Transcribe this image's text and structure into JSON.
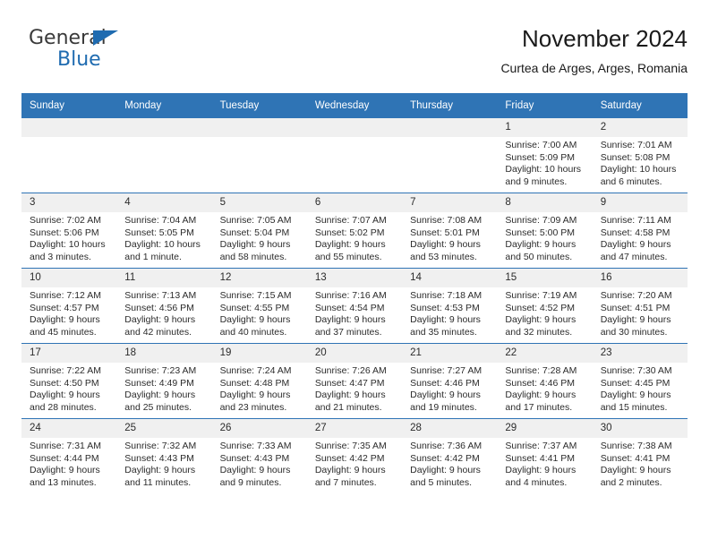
{
  "brand": {
    "name_part1": "General",
    "name_part2": "Blue",
    "triangle_color": "#1f6bb0"
  },
  "header": {
    "title": "November 2024",
    "subtitle": "Curtea de Arges, Arges, Romania"
  },
  "colors": {
    "header_blue": "#2f74b5",
    "daynum_gray": "#f0f0f0",
    "text": "#2b2b2b"
  },
  "calendar": {
    "weekday_headers": [
      "Sunday",
      "Monday",
      "Tuesday",
      "Wednesday",
      "Thursday",
      "Friday",
      "Saturday"
    ],
    "weeks": [
      [
        {
          "day": "",
          "empty": true
        },
        {
          "day": "",
          "empty": true
        },
        {
          "day": "",
          "empty": true
        },
        {
          "day": "",
          "empty": true
        },
        {
          "day": "",
          "empty": true
        },
        {
          "day": "1",
          "sunrise": "Sunrise: 7:00 AM",
          "sunset": "Sunset: 5:09 PM",
          "daylight": "Daylight: 10 hours and 9 minutes."
        },
        {
          "day": "2",
          "sunrise": "Sunrise: 7:01 AM",
          "sunset": "Sunset: 5:08 PM",
          "daylight": "Daylight: 10 hours and 6 minutes."
        }
      ],
      [
        {
          "day": "3",
          "sunrise": "Sunrise: 7:02 AM",
          "sunset": "Sunset: 5:06 PM",
          "daylight": "Daylight: 10 hours and 3 minutes."
        },
        {
          "day": "4",
          "sunrise": "Sunrise: 7:04 AM",
          "sunset": "Sunset: 5:05 PM",
          "daylight": "Daylight: 10 hours and 1 minute."
        },
        {
          "day": "5",
          "sunrise": "Sunrise: 7:05 AM",
          "sunset": "Sunset: 5:04 PM",
          "daylight": "Daylight: 9 hours and 58 minutes."
        },
        {
          "day": "6",
          "sunrise": "Sunrise: 7:07 AM",
          "sunset": "Sunset: 5:02 PM",
          "daylight": "Daylight: 9 hours and 55 minutes."
        },
        {
          "day": "7",
          "sunrise": "Sunrise: 7:08 AM",
          "sunset": "Sunset: 5:01 PM",
          "daylight": "Daylight: 9 hours and 53 minutes."
        },
        {
          "day": "8",
          "sunrise": "Sunrise: 7:09 AM",
          "sunset": "Sunset: 5:00 PM",
          "daylight": "Daylight: 9 hours and 50 minutes."
        },
        {
          "day": "9",
          "sunrise": "Sunrise: 7:11 AM",
          "sunset": "Sunset: 4:58 PM",
          "daylight": "Daylight: 9 hours and 47 minutes."
        }
      ],
      [
        {
          "day": "10",
          "sunrise": "Sunrise: 7:12 AM",
          "sunset": "Sunset: 4:57 PM",
          "daylight": "Daylight: 9 hours and 45 minutes."
        },
        {
          "day": "11",
          "sunrise": "Sunrise: 7:13 AM",
          "sunset": "Sunset: 4:56 PM",
          "daylight": "Daylight: 9 hours and 42 minutes."
        },
        {
          "day": "12",
          "sunrise": "Sunrise: 7:15 AM",
          "sunset": "Sunset: 4:55 PM",
          "daylight": "Daylight: 9 hours and 40 minutes."
        },
        {
          "day": "13",
          "sunrise": "Sunrise: 7:16 AM",
          "sunset": "Sunset: 4:54 PM",
          "daylight": "Daylight: 9 hours and 37 minutes."
        },
        {
          "day": "14",
          "sunrise": "Sunrise: 7:18 AM",
          "sunset": "Sunset: 4:53 PM",
          "daylight": "Daylight: 9 hours and 35 minutes."
        },
        {
          "day": "15",
          "sunrise": "Sunrise: 7:19 AM",
          "sunset": "Sunset: 4:52 PM",
          "daylight": "Daylight: 9 hours and 32 minutes."
        },
        {
          "day": "16",
          "sunrise": "Sunrise: 7:20 AM",
          "sunset": "Sunset: 4:51 PM",
          "daylight": "Daylight: 9 hours and 30 minutes."
        }
      ],
      [
        {
          "day": "17",
          "sunrise": "Sunrise: 7:22 AM",
          "sunset": "Sunset: 4:50 PM",
          "daylight": "Daylight: 9 hours and 28 minutes."
        },
        {
          "day": "18",
          "sunrise": "Sunrise: 7:23 AM",
          "sunset": "Sunset: 4:49 PM",
          "daylight": "Daylight: 9 hours and 25 minutes."
        },
        {
          "day": "19",
          "sunrise": "Sunrise: 7:24 AM",
          "sunset": "Sunset: 4:48 PM",
          "daylight": "Daylight: 9 hours and 23 minutes."
        },
        {
          "day": "20",
          "sunrise": "Sunrise: 7:26 AM",
          "sunset": "Sunset: 4:47 PM",
          "daylight": "Daylight: 9 hours and 21 minutes."
        },
        {
          "day": "21",
          "sunrise": "Sunrise: 7:27 AM",
          "sunset": "Sunset: 4:46 PM",
          "daylight": "Daylight: 9 hours and 19 minutes."
        },
        {
          "day": "22",
          "sunrise": "Sunrise: 7:28 AM",
          "sunset": "Sunset: 4:46 PM",
          "daylight": "Daylight: 9 hours and 17 minutes."
        },
        {
          "day": "23",
          "sunrise": "Sunrise: 7:30 AM",
          "sunset": "Sunset: 4:45 PM",
          "daylight": "Daylight: 9 hours and 15 minutes."
        }
      ],
      [
        {
          "day": "24",
          "sunrise": "Sunrise: 7:31 AM",
          "sunset": "Sunset: 4:44 PM",
          "daylight": "Daylight: 9 hours and 13 minutes."
        },
        {
          "day": "25",
          "sunrise": "Sunrise: 7:32 AM",
          "sunset": "Sunset: 4:43 PM",
          "daylight": "Daylight: 9 hours and 11 minutes."
        },
        {
          "day": "26",
          "sunrise": "Sunrise: 7:33 AM",
          "sunset": "Sunset: 4:43 PM",
          "daylight": "Daylight: 9 hours and 9 minutes."
        },
        {
          "day": "27",
          "sunrise": "Sunrise: 7:35 AM",
          "sunset": "Sunset: 4:42 PM",
          "daylight": "Daylight: 9 hours and 7 minutes."
        },
        {
          "day": "28",
          "sunrise": "Sunrise: 7:36 AM",
          "sunset": "Sunset: 4:42 PM",
          "daylight": "Daylight: 9 hours and 5 minutes."
        },
        {
          "day": "29",
          "sunrise": "Sunrise: 7:37 AM",
          "sunset": "Sunset: 4:41 PM",
          "daylight": "Daylight: 9 hours and 4 minutes."
        },
        {
          "day": "30",
          "sunrise": "Sunrise: 7:38 AM",
          "sunset": "Sunset: 4:41 PM",
          "daylight": "Daylight: 9 hours and 2 minutes."
        }
      ]
    ]
  }
}
